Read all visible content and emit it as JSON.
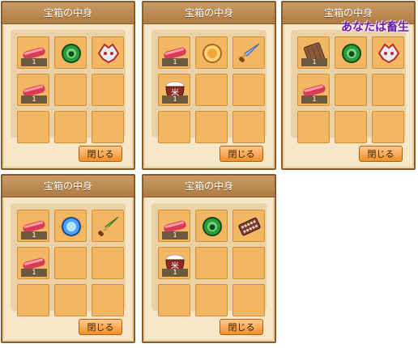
{
  "panels": [
    {
      "title": "宝箱の中身",
      "close_label": "閉じる",
      "overlay_text": "",
      "slots": [
        {
          "icon": "red-bar-icon",
          "count": "1"
        },
        {
          "icon": "green-orb-icon",
          "count": ""
        },
        {
          "icon": "skull-helmet-icon",
          "count": ""
        },
        {
          "icon": "red-bar-icon",
          "count": "1"
        },
        {
          "icon": "",
          "count": ""
        },
        {
          "icon": "",
          "count": ""
        },
        {
          "icon": "",
          "count": ""
        },
        {
          "icon": "",
          "count": ""
        },
        {
          "icon": "",
          "count": ""
        }
      ]
    },
    {
      "title": "宝箱の中身",
      "close_label": "閉じる",
      "overlay_text": "",
      "slots": [
        {
          "icon": "red-bar-icon",
          "count": "1"
        },
        {
          "icon": "orange-orb-icon",
          "count": ""
        },
        {
          "icon": "blue-dagger-icon",
          "count": ""
        },
        {
          "icon": "rice-pot-icon",
          "count": "1"
        },
        {
          "icon": "",
          "count": ""
        },
        {
          "icon": "",
          "count": ""
        },
        {
          "icon": "",
          "count": ""
        },
        {
          "icon": "",
          "count": ""
        },
        {
          "icon": "",
          "count": ""
        }
      ]
    },
    {
      "title": "宝箱の中身",
      "close_label": "閉じる",
      "overlay_text": "あなたは畜生",
      "slots": [
        {
          "icon": "wood-plank-icon",
          "count": "1"
        },
        {
          "icon": "green-orb-icon",
          "count": ""
        },
        {
          "icon": "skull-helmet-icon",
          "count": ""
        },
        {
          "icon": "red-bar-icon",
          "count": "1"
        },
        {
          "icon": "",
          "count": ""
        },
        {
          "icon": "",
          "count": ""
        },
        {
          "icon": "",
          "count": ""
        },
        {
          "icon": "",
          "count": ""
        },
        {
          "icon": "",
          "count": ""
        }
      ]
    },
    {
      "title": "宝箱の中身",
      "close_label": "閉じる",
      "overlay_text": "",
      "slots": [
        {
          "icon": "red-bar-icon",
          "count": "1"
        },
        {
          "icon": "blue-orb-icon",
          "count": ""
        },
        {
          "icon": "green-sword-icon",
          "count": ""
        },
        {
          "icon": "red-bar-icon",
          "count": "1"
        },
        {
          "icon": "",
          "count": ""
        },
        {
          "icon": "",
          "count": ""
        },
        {
          "icon": "",
          "count": ""
        },
        {
          "icon": "",
          "count": ""
        },
        {
          "icon": "",
          "count": ""
        }
      ]
    },
    {
      "title": "宝箱の中身",
      "close_label": "閉じる",
      "overlay_text": "",
      "slots": [
        {
          "icon": "red-bar-icon",
          "count": "1"
        },
        {
          "icon": "green-orb-icon",
          "count": ""
        },
        {
          "icon": "abacus-icon",
          "count": ""
        },
        {
          "icon": "rice-pot-icon",
          "count": "1"
        },
        {
          "icon": "",
          "count": ""
        },
        {
          "icon": "",
          "count": ""
        },
        {
          "icon": "",
          "count": ""
        },
        {
          "icon": "",
          "count": ""
        },
        {
          "icon": "",
          "count": ""
        }
      ]
    }
  ]
}
